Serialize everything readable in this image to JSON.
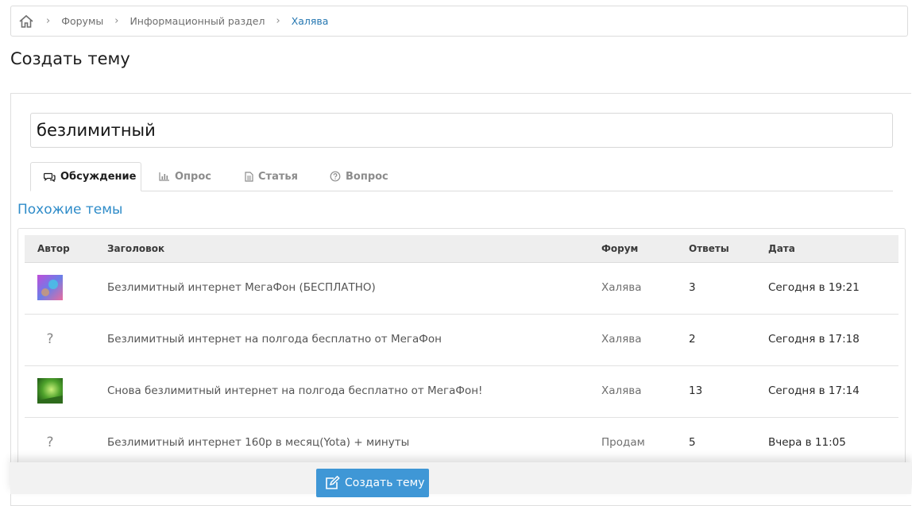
{
  "breadcrumb": {
    "home_icon": "home-icon",
    "items": [
      "Форумы",
      "Информационный раздел"
    ],
    "current": "Халява"
  },
  "page_title": "Создать тему",
  "form": {
    "title_value": "безлимитный"
  },
  "tabs": [
    {
      "label": "Обсуждение",
      "icon": "discussion-icon",
      "active": true
    },
    {
      "label": "Опрос",
      "icon": "poll-chart-icon",
      "active": false
    },
    {
      "label": "Статья",
      "icon": "article-document-icon",
      "active": false
    },
    {
      "label": "Вопрос",
      "icon": "question-circle-icon",
      "active": false
    }
  ],
  "similar": {
    "title": "Похожие темы",
    "columns": [
      "Автор",
      "Заголовок",
      "Форум",
      "Ответы",
      "Дата"
    ],
    "rows": [
      {
        "avatar": "image",
        "title": "Безлимитный интернет МегаФон (БЕСПЛАТНО)",
        "forum": "Халява",
        "replies": "3",
        "date": "Сегодня в 19:21"
      },
      {
        "avatar": "?",
        "title": "Безлимитный интернет на полгода бесплатно от МегаФон",
        "forum": "Халява",
        "replies": "2",
        "date": "Сегодня в 17:18"
      },
      {
        "avatar": "image",
        "title": "Снова безлимитный интернет на полгода бесплатно от МегаФон!",
        "forum": "Халява",
        "replies": "13",
        "date": "Сегодня в 17:14"
      },
      {
        "avatar": "?",
        "title": "Безлимитный интернет 160р в месяц(Yota) + минуты",
        "forum": "Продам",
        "replies": "5",
        "date": "Вчера в 11:05"
      }
    ]
  },
  "submit": {
    "label": "Создать тему",
    "icon": "edit-icon"
  },
  "colors": {
    "accent": "#2f8cc9",
    "button": "#3f97d6",
    "breadcrumb_current": "#2577b1"
  }
}
